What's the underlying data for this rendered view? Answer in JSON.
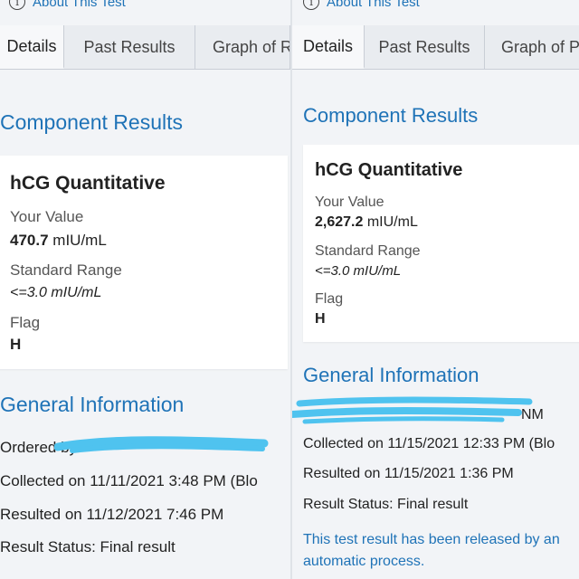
{
  "left": {
    "about_label": "About This Test",
    "tabs": [
      {
        "label": "Details"
      },
      {
        "label": "Past Results"
      },
      {
        "label": "Graph of R"
      }
    ],
    "component_results_title": "Component Results",
    "component": {
      "name": "hCG Quantitative",
      "your_value_label": "Your Value",
      "value": "470.7",
      "unit": "mIU/mL",
      "standard_range_label": "Standard Range",
      "standard_range": "<=3.0 mIU/mL",
      "flag_label": "Flag",
      "flag": "H"
    },
    "general_information_title": "General Information",
    "info": {
      "ordered_by": "Ordered by",
      "collected": "Collected on 11/11/2021 3:48 PM (Blo",
      "resulted": "Resulted on 11/12/2021 7:46 PM",
      "status": "Result Status: Final result"
    }
  },
  "right": {
    "about_label": "About This Test",
    "tabs": [
      {
        "label": "Details"
      },
      {
        "label": "Past Results"
      },
      {
        "label": "Graph of Pa"
      }
    ],
    "component_results_title": "Component Results",
    "component": {
      "name": "hCG Quantitative",
      "your_value_label": "Your Value",
      "value": "2,627.2",
      "unit": "mIU/mL",
      "standard_range_label": "Standard Range",
      "standard_range": "<=3.0 mIU/mL",
      "flag_label": "Flag",
      "flag": "H"
    },
    "general_information_title": "General Information",
    "info": {
      "ordered_by_tail": "NM",
      "collected": "Collected on 11/15/2021 12:33 PM (Blo",
      "resulted": "Resulted on 11/15/2021 1:36 PM",
      "status": "Result Status: Final result"
    },
    "release_note": "This test result has been released by an automatic process."
  },
  "colors": {
    "link_blue": "#1f73b7",
    "redaction_blue": "#4fc3ef",
    "background": "#f2f4f7",
    "card": "#ffffff"
  }
}
